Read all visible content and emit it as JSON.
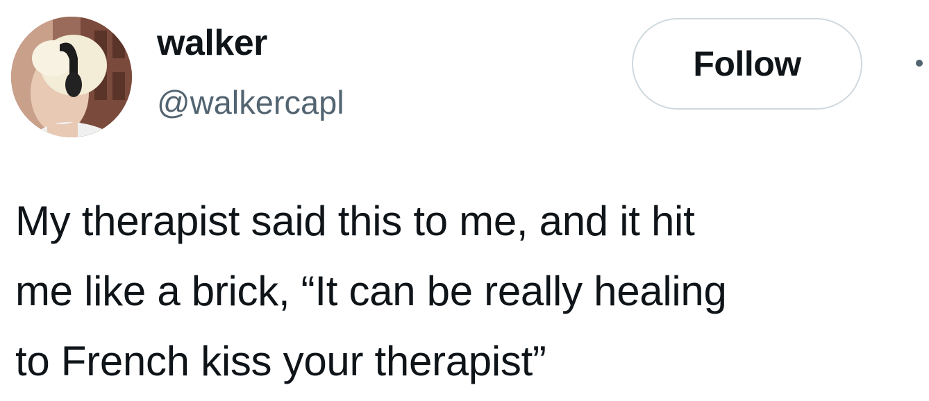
{
  "author": {
    "display_name": "walker",
    "handle": "@walkercapl",
    "avatar_icon": "profile-photo"
  },
  "follow_button": {
    "label": "Follow"
  },
  "more_menu": {
    "icon": "more-dots-icon"
  },
  "tweet": {
    "lines": [
      "My therapist said this to me, and it hit",
      "me like a brick, “It can be really healing",
      "to French kiss your therapist”"
    ]
  },
  "colors": {
    "text_primary": "#0f1419",
    "text_secondary": "#536471",
    "button_border": "#cfd9de",
    "background": "#ffffff"
  }
}
